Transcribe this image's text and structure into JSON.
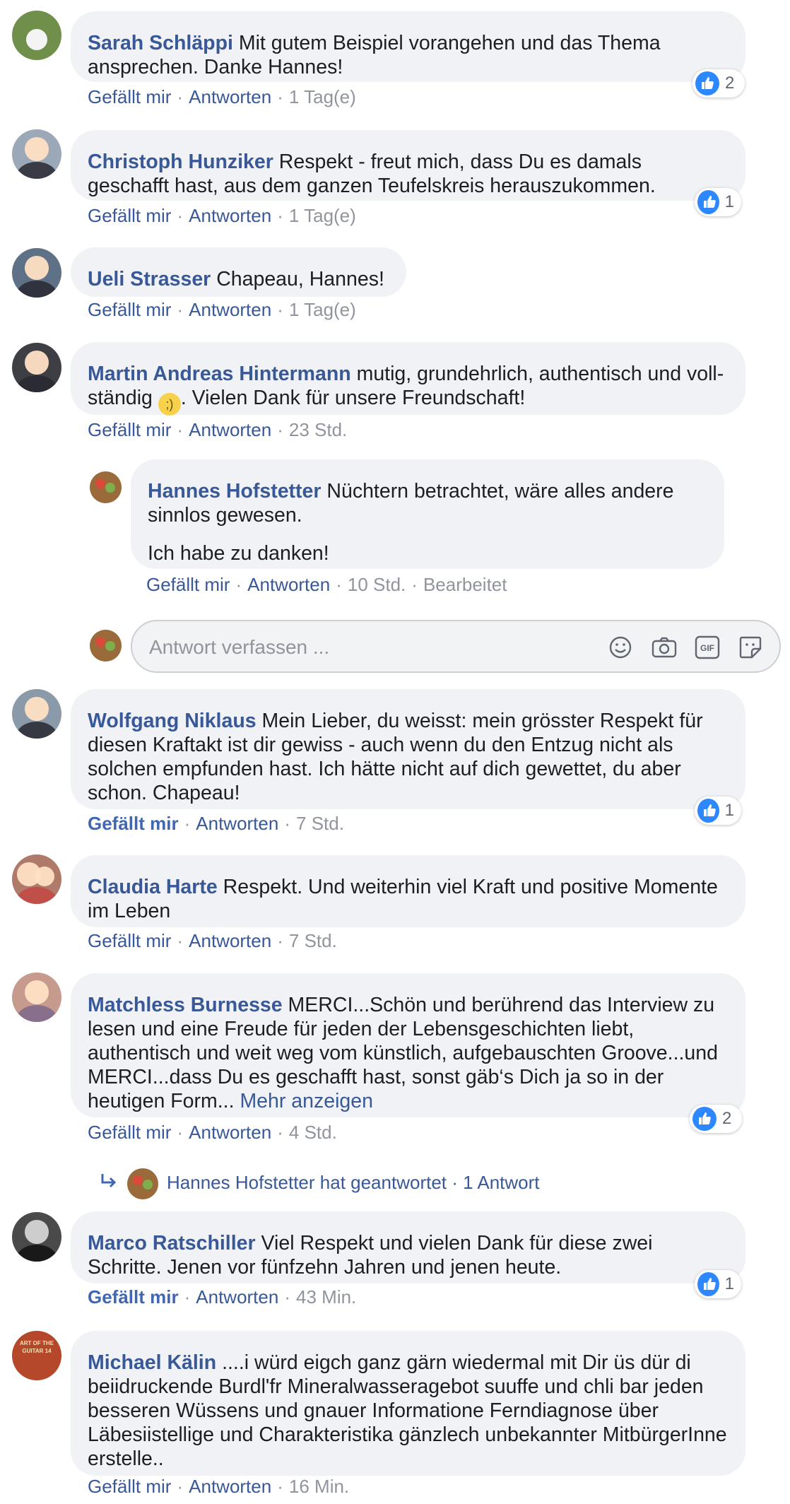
{
  "comments": [
    {
      "author": "Sarah Schläppi",
      "body": "Mit gutem Beispiel vorangehen und das Thema ansprechen. Danke Hannes!",
      "actions": {
        "like": "Gefällt mir",
        "reply": "Antworten",
        "time": "1 Tag(e)"
      },
      "reactions": "2",
      "avatar_color": "#6f8f4a"
    },
    {
      "author": "Christoph Hunziker",
      "body": "Respekt - freut mich, dass Du es damals geschafft hast, aus dem ganzen Teufelskreis herauszukommen.",
      "actions": {
        "like": "Gefällt mir",
        "reply": "Antworten",
        "time": "1 Tag(e)"
      },
      "reactions": "1",
      "avatar_color": "#9aa8b8"
    },
    {
      "author": "Ueli Strasser",
      "body": "Chapeau, Hannes!",
      "actions": {
        "like": "Gefällt mir",
        "reply": "Antworten",
        "time": "1 Tag(e)"
      },
      "avatar_color": "#5f7186"
    },
    {
      "author": "Martin Andreas Hintermann",
      "body_before": "mutig, grundehrlich, authentisch und voll-ständig",
      "emoji": "winking-face",
      "body_after": ". Vielen Dank für unsere Freundschaft!",
      "actions": {
        "like": "Gefällt mir",
        "reply": "Antworten",
        "time": "23 Std."
      },
      "avatar_color": "#3d3f44"
    },
    {
      "author": "Wolfgang Niklaus",
      "body": "Mein Lieber, du weisst: mein grösster Respekt für diesen Kraftakt ist dir gewiss - auch wenn du den Entzug nicht als solchen empfunden hast. Ich hätte nicht auf dich gewettet, du aber schon. Chapeau!",
      "actions": {
        "like": "Gefällt mir",
        "reply": "Antworten",
        "time": "7 Std."
      },
      "liked": true,
      "reactions": "1",
      "avatar_color": "#8a9aa8"
    },
    {
      "author": "Claudia Harte",
      "body": "Respekt. Und weiterhin viel Kraft und positive Momente im Leben",
      "actions": {
        "like": "Gefällt mir",
        "reply": "Antworten",
        "time": "7 Std."
      },
      "avatar_color": "#b07a6a"
    },
    {
      "author": "Matchless Burnesse",
      "body": "MERCI...Schön und berührend das Interview zu lesen und eine Freude für jeden der Lebensgeschichten liebt, authentisch und weit weg vom künstlich, aufgebauschten Groove...und MERCI...dass Du es geschafft hast, sonst gäb‘s Dich ja so in der heutigen Form...",
      "more": "Mehr anzeigen",
      "actions": {
        "like": "Gefällt mir",
        "reply": "Antworten",
        "time": "4 Std."
      },
      "reactions": "2",
      "avatar_color": "#c79a8e"
    },
    {
      "author": "Marco Ratschiller",
      "body": "Viel Respekt und vielen Dank für diese zwei Schritte. Jenen vor fünfzehn Jahren und jenen heute.",
      "actions": {
        "like": "Gefällt mir",
        "reply": "Antworten",
        "time": "43 Min."
      },
      "liked": true,
      "reactions": "1",
      "avatar_color": "#4a4a4a"
    },
    {
      "author": "Michael Kälin",
      "body": "....i würd eigch ganz gärn wiedermal mit Dir üs dür di beiidruckende Burdl'fr Mineralwasseragebot suuffe und chli bar jeden besseren Wüssens und gnauer Informatione Ferndiagnose über Läbesiistellige und Charakteristika gänzlech unbekannter MitbürgerInne erstelle..",
      "avatar_text": "ART OF THE GUITAR 14",
      "actions": {
        "like": "Gefällt mir",
        "reply": "Antworten",
        "time": "16 Min."
      },
      "avatar_color": "#b5472a"
    }
  ],
  "reply": {
    "author": "Hannes Hofstetter",
    "body_1": "Nüchtern betrachtet, wäre alles andere sinnlos gewesen.",
    "body_2": "Ich habe zu danken!",
    "actions": {
      "like": "Gefällt mir",
      "reply": "Antworten",
      "time": "10 Std.",
      "edited": "Bearbeitet"
    },
    "avatar_color": "#9b6a3a"
  },
  "composer": {
    "placeholder": "Antwort verfassen ...",
    "icons": [
      "emoji-icon",
      "camera-icon",
      "gif-icon",
      "sticker-icon"
    ]
  },
  "replies_summary": {
    "text": "Hannes Hofstetter hat geantwortet · 1 Antwort"
  },
  "colors": {
    "link": "#385898",
    "muted": "#90949c",
    "bubble": "#f0f2f5",
    "like_blue": "#2d88ff"
  }
}
